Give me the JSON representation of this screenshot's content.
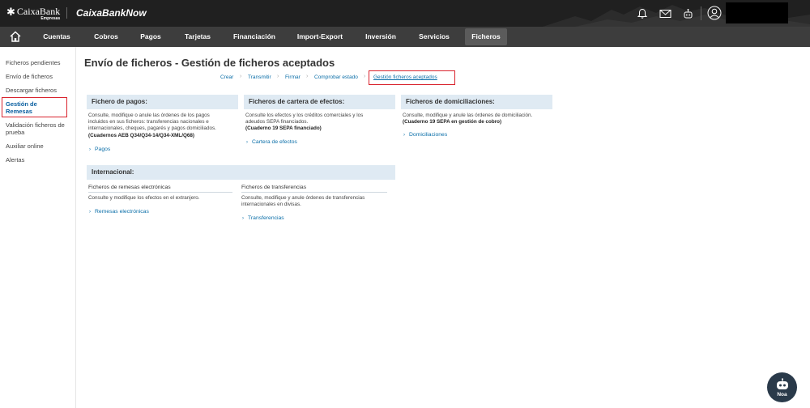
{
  "header": {
    "brand": "CaixaBank",
    "brand_sub": "Empresas",
    "product": "CaixaBankNow"
  },
  "nav": {
    "items": [
      {
        "label": "Cuentas"
      },
      {
        "label": "Cobros"
      },
      {
        "label": "Pagos"
      },
      {
        "label": "Tarjetas"
      },
      {
        "label": "Financiación"
      },
      {
        "label": "Import-Export"
      },
      {
        "label": "Inversión"
      },
      {
        "label": "Servicios"
      },
      {
        "label": "Ficheros"
      }
    ],
    "active": "Ficheros"
  },
  "sidebar": {
    "items": [
      {
        "label": "Ficheros pendientes"
      },
      {
        "label": "Envío de ficheros"
      },
      {
        "label": "Descargar ficheros"
      },
      {
        "label": "Gestión de Remesas"
      },
      {
        "label": "Validación ficheros de prueba"
      },
      {
        "label": "Auxiliar online"
      },
      {
        "label": "Alertas"
      }
    ],
    "active": "Gestión de Remesas"
  },
  "page": {
    "title": "Envío de ficheros - Gestión de ficheros aceptados",
    "steps": [
      {
        "label": "Crear"
      },
      {
        "label": "Transmitir"
      },
      {
        "label": "Firmar"
      },
      {
        "label": "Comprobar estado"
      },
      {
        "label": "Gestión ficheros aceptados"
      }
    ]
  },
  "cards": {
    "pagos": {
      "title": "Fichero de pagos:",
      "text1": "Consulte, modifique o anule las órdenes de los pagos",
      "text2": "incluidos en sus ficheros: transferencias nacionales e",
      "text3": "internacionales, cheques, pagarés y pagos domiciliados.",
      "bold": "(Cuadernos AEB Q34/Q34-14/Q34-XML/Q68)",
      "link": "Pagos"
    },
    "cartera": {
      "title": "Ficheros de cartera de efectos:",
      "text1": "Consulte los efectos y los créditos comerciales y los",
      "text2": "adeudos SEPA financiados.",
      "bold": "(Cuaderno 19 SEPA financiado)",
      "link": "Cartera de efectos"
    },
    "domiciliaciones": {
      "title": "Ficheros de domiciliaciones:",
      "text1": "Consulte, modifique y anule las órdenes de domiciliación.",
      "bold": "(Cuaderno 19 SEPA en gestión de cobro)",
      "link": "Domiciliaciones"
    },
    "internacional": {
      "title": "Internacional:",
      "remesas_head": "Ficheros de remesas electrónicas",
      "remesas_text": "Consulte y modifique los efectos en el extranjero.",
      "remesas_link": "Remesas electrónicas",
      "transf_head": "Ficheros de transferencias",
      "transf_text1": "Consulte, modifique y anule órdenes de transferencias",
      "transf_text2": "internacionales en divisas.",
      "transf_link": "Transferencias"
    }
  },
  "bot": {
    "label": "Noa"
  }
}
